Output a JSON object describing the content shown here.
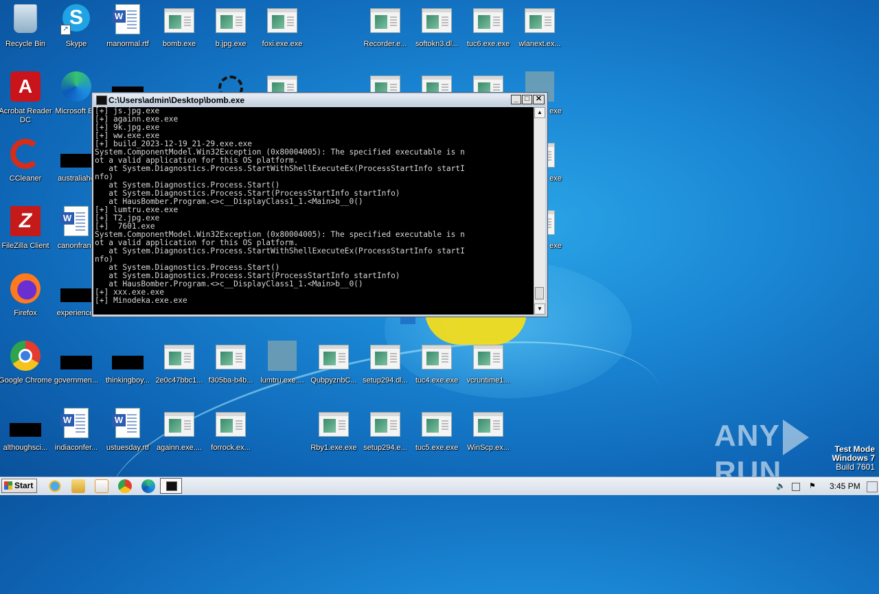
{
  "desktop": {
    "icons": [
      {
        "label": "Recycle Bin"
      },
      {
        "label": "Skype"
      },
      {
        "label": "manormal.rtf"
      },
      {
        "label": "bomb.exe"
      },
      {
        "label": "b.jpg.exe"
      },
      {
        "label": "foxi.exe.exe"
      },
      {
        "label": "Recorder.e..."
      },
      {
        "label": "softokn3.dl..."
      },
      {
        "label": "tuc6.exe.exe"
      },
      {
        "label": "wlanext.ex..."
      },
      {
        "label": "Acrobat Reader DC"
      },
      {
        "label": "Microsoft Ed"
      },
      {
        "label": "CCleaner"
      },
      {
        "label": "australiaho"
      },
      {
        "label": "FileZilla Client"
      },
      {
        "label": "canonfranc"
      },
      {
        "label": "Firefox"
      },
      {
        "label": "experiencet"
      },
      {
        "label": "Google Chrome"
      },
      {
        "label": "governmen..."
      },
      {
        "label": "thinkingboy..."
      },
      {
        "label": "2e0c47bbc1..."
      },
      {
        "label": "f305ba-b4b..."
      },
      {
        "label": "lumtru.exe...."
      },
      {
        "label": "QubpyznbC..."
      },
      {
        "label": "setup294.dl..."
      },
      {
        "label": "tuc4.exe.exe"
      },
      {
        "label": "vcruntime1..."
      },
      {
        "label": "althoughsci..."
      },
      {
        "label": "indiaconfer..."
      },
      {
        "label": "ustuesday.rtf"
      },
      {
        "label": "againn.exe...."
      },
      {
        "label": "forrock.ex..."
      },
      {
        "label": "Rby1.exe.exe"
      },
      {
        "label": "setup294.e..."
      },
      {
        "label": "tuc5.exe.exe"
      },
      {
        "label": "WinScp.ex..."
      },
      {
        "label": "exe"
      },
      {
        "label": "exe"
      },
      {
        "label": "exe"
      }
    ]
  },
  "console": {
    "title": "C:\\Users\\admin\\Desktop\\bomb.exe",
    "lines": [
      "[+] js.jpg.exe",
      "[+] againn.exe.exe",
      "[+] 9k.jpg.exe",
      "[+] ww.exe.exe",
      "[+] build_2023-12-19_21-29.exe.exe",
      "System.ComponentModel.Win32Exception (0x80004005): The specified executable is n",
      "ot a valid application for this OS platform.",
      "   at System.Diagnostics.Process.StartWithShellExecuteEx(ProcessStartInfo startI",
      "nfo)",
      "   at System.Diagnostics.Process.Start()",
      "   at System.Diagnostics.Process.Start(ProcessStartInfo startInfo)",
      "   at HausBomber.Program.<>c__DisplayClass1_1.<Main>b__0()",
      "[+] lumtru.exe.exe",
      "[+] T2.jpg.exe",
      "[+]  7601.exe",
      "System.ComponentModel.Win32Exception (0x80004005): The specified executable is n",
      "ot a valid application for this OS platform.",
      "   at System.Diagnostics.Process.StartWithShellExecuteEx(ProcessStartInfo startI",
      "nfo)",
      "   at System.Diagnostics.Process.Start()",
      "   at System.Diagnostics.Process.Start(ProcessStartInfo startInfo)",
      "   at HausBomber.Program.<>c__DisplayClass1_1.<Main>b__0()",
      "[+] xxx.exe.exe",
      "[+] Minodeka.exe.exe"
    ],
    "minimize": "_",
    "maximize": "□",
    "close": "✕"
  },
  "watermark": {
    "left": "ANY",
    "right": "RUN"
  },
  "testmode": {
    "line1": "Test Mode",
    "line2": "Windows 7",
    "line3": "Build 7601"
  },
  "taskbar": {
    "start_label": "Start",
    "clock": "3:45 PM"
  }
}
